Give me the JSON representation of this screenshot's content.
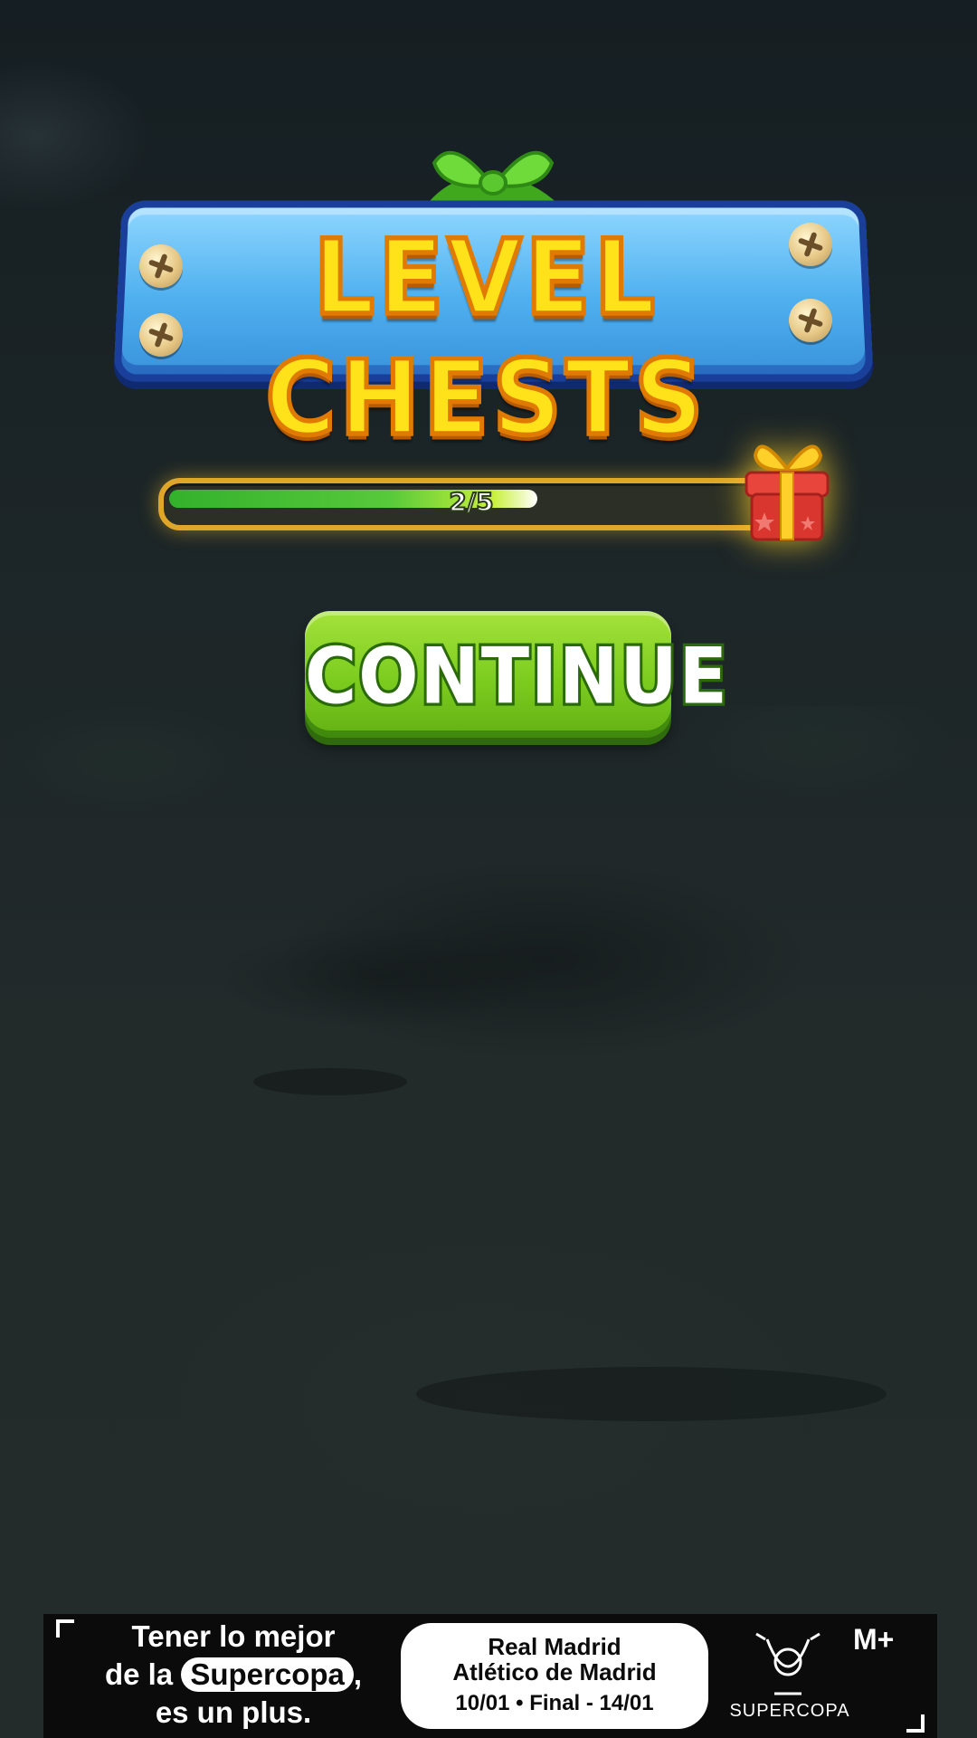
{
  "title": "LEVEL CHESTS",
  "progress": {
    "label": "2/5",
    "current": 2,
    "total": 5,
    "fill_fraction": 0.61,
    "reward_icon": "gift-box-icon"
  },
  "continue_button": {
    "label": "CONTINUE"
  },
  "ad": {
    "line1": "Tener lo mejor",
    "line2_prefix": "de la ",
    "line2_highlight": "Supercopa",
    "line2_suffix": ",",
    "line3": "es un plus.",
    "match_line1": "Real Madrid",
    "match_line2": "Atlético de Madrid",
    "match_line3": "10/01  •  Final - 14/01",
    "brand": "SUPERCOPA",
    "logo": "M+"
  },
  "colors": {
    "background": "#1b2324",
    "banner_blue": "#4fb0ef",
    "title_yellow": "#ffe21a",
    "progress_green": "#57c93b",
    "progress_border": "#e0a628",
    "button_green": "#7ccc1f"
  }
}
